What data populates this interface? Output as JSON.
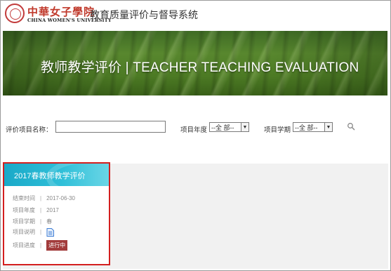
{
  "header": {
    "logo_cn": "中華女子學院",
    "logo_en": "CHINA WOMEN'S UNIVERSITY",
    "system_title": "教育质量评价与督导系统"
  },
  "banner": {
    "title": "教师教学评价 | TEACHER TEACHING EVALUATION"
  },
  "filters": {
    "name_label": "评价项目名称：",
    "name_value": "",
    "year_label": "项目年度",
    "year_selected": "--全 部--",
    "term_label": "项目学期",
    "term_selected": "--全 部--",
    "search_icon": "search-icon"
  },
  "card": {
    "title": "2017春教师教学评价",
    "separator": "|",
    "rows": [
      {
        "key": "结束时间",
        "value": "2017-06-30"
      },
      {
        "key": "项目年度",
        "value": "2017"
      },
      {
        "key": "项目学期",
        "value": "春"
      },
      {
        "key": "项目说明",
        "value": ""
      },
      {
        "key": "项目进度",
        "value": "进行中"
      }
    ]
  },
  "colors": {
    "accent_red": "#d31f1f",
    "card_header": "#2fbfd8",
    "status_badge": "#a23b3b"
  }
}
